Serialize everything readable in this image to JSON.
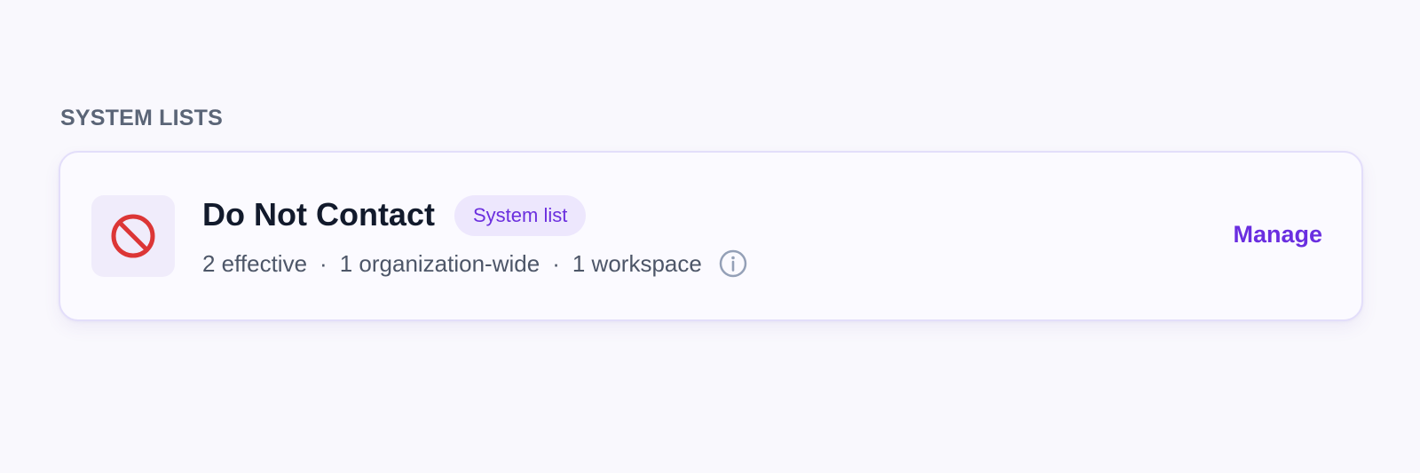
{
  "section": {
    "title": "SYSTEM LISTS"
  },
  "card": {
    "icon": "prohibited-icon",
    "name": "Do Not Contact",
    "badge": "System list",
    "stats": {
      "effective": "2 effective",
      "organization": "1 organization-wide",
      "workspace": "1 workspace",
      "separator": "·"
    },
    "info_icon": "info-icon",
    "action_label": "Manage"
  },
  "colors": {
    "background": "#f9f8fd",
    "card_border": "#e3defa",
    "icon_red": "#dc3636",
    "accent_purple": "#6a2ee0",
    "badge_bg": "#ede7fd",
    "info_gray": "#94a0b7"
  }
}
